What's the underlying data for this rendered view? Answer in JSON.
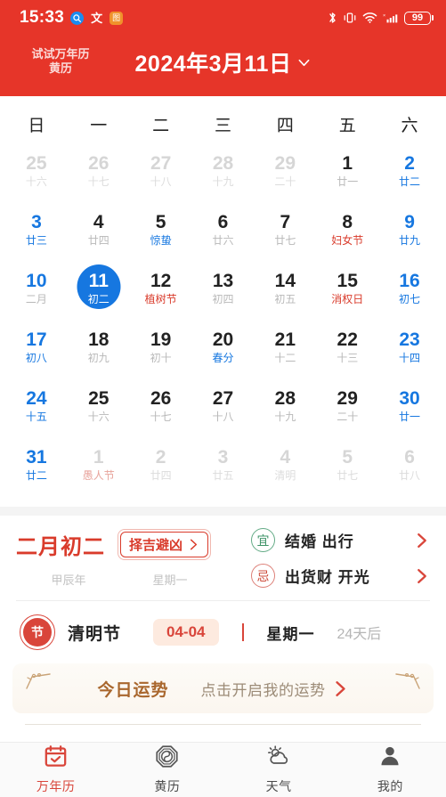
{
  "status_bar": {
    "time": "15:33",
    "left_icons": [
      {
        "name": "search-badge-icon",
        "glyph": "●"
      },
      {
        "name": "wen-glyph-icon",
        "glyph": "文"
      },
      {
        "name": "app-badge-icon",
        "glyph": "图"
      }
    ],
    "right_icons": [
      "bluetooth-icon",
      "vibrate-icon",
      "wifi-icon",
      "cellular-signal-icon"
    ],
    "battery_level": "99"
  },
  "header": {
    "brand_line1": "试试万年历",
    "brand_line2": "黄历",
    "date_title": "2024年3月11日",
    "chevron": "chevron-down-icon",
    "bg_color": "#e63529"
  },
  "calendar": {
    "weekdays": [
      "日",
      "一",
      "二",
      "三",
      "四",
      "五",
      "六"
    ],
    "weeks": [
      [
        {
          "num": "25",
          "sub": "十六",
          "style": "muted"
        },
        {
          "num": "26",
          "sub": "十七",
          "style": "muted"
        },
        {
          "num": "27",
          "sub": "十八",
          "style": "muted"
        },
        {
          "num": "28",
          "sub": "十九",
          "style": "muted"
        },
        {
          "num": "29",
          "sub": "二十",
          "style": "muted"
        },
        {
          "num": "1",
          "sub": "廿一",
          "style": "normal"
        },
        {
          "num": "2",
          "sub": "廿二",
          "style": "blue"
        }
      ],
      [
        {
          "num": "3",
          "sub": "廿三",
          "style": "blue"
        },
        {
          "num": "4",
          "sub": "廿四",
          "style": "normal"
        },
        {
          "num": "5",
          "sub": "惊蛰",
          "style": "term"
        },
        {
          "num": "6",
          "sub": "廿六",
          "style": "normal"
        },
        {
          "num": "7",
          "sub": "廿七",
          "style": "normal"
        },
        {
          "num": "8",
          "sub": "妇女节",
          "style": "fest"
        },
        {
          "num": "9",
          "sub": "廿九",
          "style": "blue"
        }
      ],
      [
        {
          "num": "10",
          "sub": "二月",
          "style": "blue-sub-gray"
        },
        {
          "num": "11",
          "sub": "初二",
          "style": "selected"
        },
        {
          "num": "12",
          "sub": "植树节",
          "style": "fest"
        },
        {
          "num": "13",
          "sub": "初四",
          "style": "normal"
        },
        {
          "num": "14",
          "sub": "初五",
          "style": "normal"
        },
        {
          "num": "15",
          "sub": "消权日",
          "style": "fest"
        },
        {
          "num": "16",
          "sub": "初七",
          "style": "blue"
        }
      ],
      [
        {
          "num": "17",
          "sub": "初八",
          "style": "blue"
        },
        {
          "num": "18",
          "sub": "初九",
          "style": "normal"
        },
        {
          "num": "19",
          "sub": "初十",
          "style": "normal"
        },
        {
          "num": "20",
          "sub": "春分",
          "style": "term"
        },
        {
          "num": "21",
          "sub": "十二",
          "style": "normal"
        },
        {
          "num": "22",
          "sub": "十三",
          "style": "normal"
        },
        {
          "num": "23",
          "sub": "十四",
          "style": "blue"
        }
      ],
      [
        {
          "num": "24",
          "sub": "十五",
          "style": "blue"
        },
        {
          "num": "25",
          "sub": "十六",
          "style": "normal"
        },
        {
          "num": "26",
          "sub": "十七",
          "style": "normal"
        },
        {
          "num": "27",
          "sub": "十八",
          "style": "normal"
        },
        {
          "num": "28",
          "sub": "十九",
          "style": "normal"
        },
        {
          "num": "29",
          "sub": "二十",
          "style": "normal"
        },
        {
          "num": "30",
          "sub": "廿一",
          "style": "blue"
        }
      ],
      [
        {
          "num": "31",
          "sub": "廿二",
          "style": "blue"
        },
        {
          "num": "1",
          "sub": "愚人节",
          "style": "muted-fest"
        },
        {
          "num": "2",
          "sub": "廿四",
          "style": "muted"
        },
        {
          "num": "3",
          "sub": "廿五",
          "style": "muted"
        },
        {
          "num": "4",
          "sub": "清明",
          "style": "muted"
        },
        {
          "num": "5",
          "sub": "廿七",
          "style": "muted"
        },
        {
          "num": "6",
          "sub": "廿八",
          "style": "muted"
        }
      ]
    ]
  },
  "lunar": {
    "lunar_date": "二月初二",
    "zeji_button": "择吉避凶",
    "ganzhi_year": "甲辰年",
    "weekday": "星期一",
    "yi_label": "宜",
    "yi_items": "结婚 出行",
    "ji_label": "忌",
    "ji_items": "出货财 开光"
  },
  "festival": {
    "badge_text": "节",
    "name": "清明节",
    "date": "04-04",
    "weekday": "星期一",
    "countdown": "24天后"
  },
  "fortune": {
    "title": "今日运势",
    "cta": "点击开启我的运势"
  },
  "tabbar": {
    "items": [
      {
        "label": "万年历",
        "icon": "calendar-check-icon",
        "active": true
      },
      {
        "label": "黄历",
        "icon": "bagua-icon",
        "active": false
      },
      {
        "label": "天气",
        "icon": "weather-sun-cloud-icon",
        "active": false
      },
      {
        "label": "我的",
        "icon": "person-icon",
        "active": false
      }
    ]
  },
  "colors": {
    "brand_red": "#e63529",
    "accent_red": "#d9453a",
    "selected_blue": "#1677e0",
    "green": "#3f9468",
    "gold": "#a9672e"
  }
}
